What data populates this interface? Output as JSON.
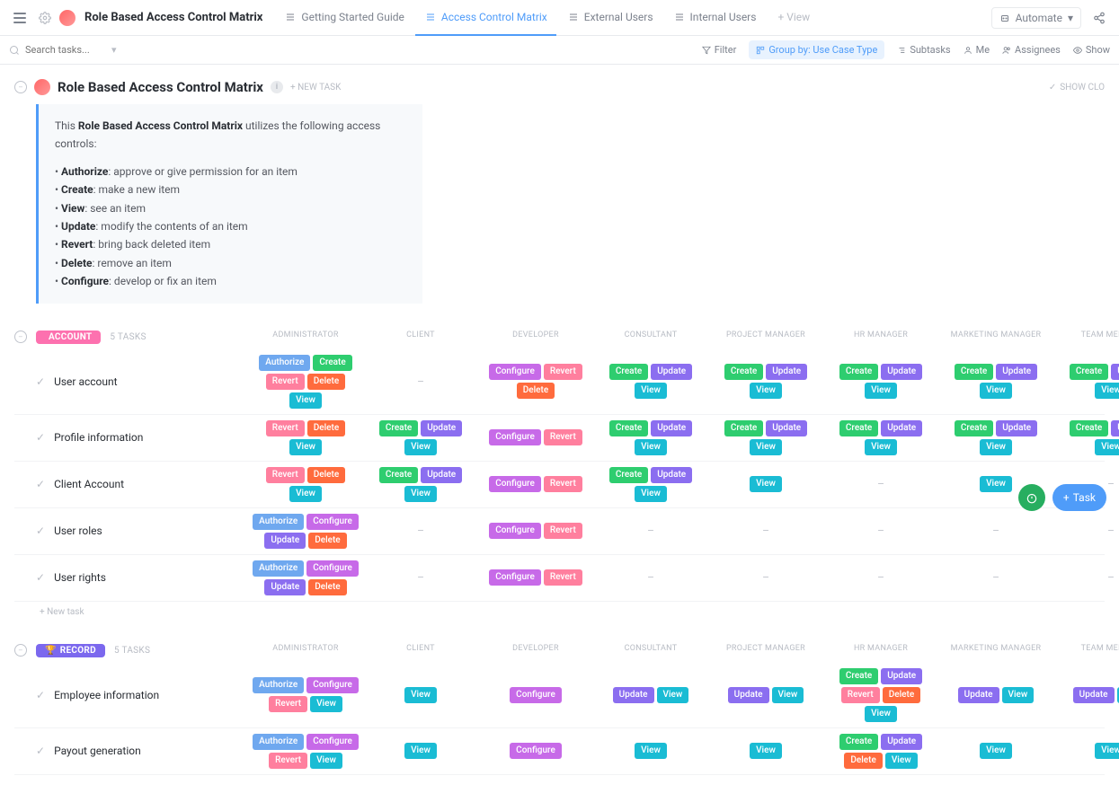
{
  "header": {
    "title": "Role Based Access Control Matrix",
    "automate": "Automate"
  },
  "tabs": [
    {
      "label": "Getting Started Guide",
      "active": false
    },
    {
      "label": "Access Control Matrix",
      "active": true
    },
    {
      "label": "External Users",
      "active": false
    },
    {
      "label": "Internal Users",
      "active": false
    }
  ],
  "add_view": "+ View",
  "search": {
    "placeholder": "Search tasks..."
  },
  "toolbar": {
    "filter": "Filter",
    "group_by": "Group by: Use Case Type",
    "subtasks": "Subtasks",
    "me": "Me",
    "assignees": "Assignees",
    "show": "Show"
  },
  "main": {
    "title": "Role Based Access Control Matrix",
    "new_task": "+ NEW TASK",
    "show_closed": "SHOW CLO"
  },
  "description": {
    "intro_pre": "This ",
    "intro_bold": "Role Based Access Control Matrix",
    "intro_post": " utilizes the following access controls:",
    "items": [
      {
        "term": "Authorize",
        "def": ": approve or give permission for an item"
      },
      {
        "term": "Create",
        "def": ": make a new item"
      },
      {
        "term": "View",
        "def": ": see an item"
      },
      {
        "term": "Update",
        "def": ": modify the contents of an item"
      },
      {
        "term": "Revert",
        "def": ": bring back deleted item"
      },
      {
        "term": "Delete",
        "def": ": remove an item"
      },
      {
        "term": "Configure",
        "def": ": develop or fix an item"
      }
    ]
  },
  "columns": [
    "ADMINISTRATOR",
    "CLIENT",
    "DEVELOPER",
    "CONSULTANT",
    "PROJECT MANAGER",
    "HR MANAGER",
    "MARKETING MANAGER",
    "TEAM MEMBER"
  ],
  "groups": [
    {
      "name": "ACCOUNT",
      "class": "account",
      "count": "5 TASKS",
      "tasks": [
        {
          "name": "User account",
          "cells": [
            [
              "Authorize",
              "Create",
              "Revert",
              "Delete",
              "View"
            ],
            [],
            [
              "Configure",
              "Revert",
              "Delete"
            ],
            [
              "Create",
              "Update",
              "View"
            ],
            [
              "Create",
              "Update",
              "View"
            ],
            [
              "Create",
              "Update",
              "View"
            ],
            [
              "Create",
              "Update",
              "View"
            ],
            [
              "Create",
              "Update",
              "View"
            ]
          ]
        },
        {
          "name": "Profile information",
          "cells": [
            [
              "Revert",
              "Delete",
              "View"
            ],
            [
              "Create",
              "Update",
              "View"
            ],
            [
              "Configure",
              "Revert"
            ],
            [
              "Create",
              "Update",
              "View"
            ],
            [
              "Create",
              "Update",
              "View"
            ],
            [
              "Create",
              "Update",
              "View"
            ],
            [
              "Create",
              "Update",
              "View"
            ],
            [
              "Create",
              "Update",
              "View"
            ]
          ]
        },
        {
          "name": "Client Account",
          "cells": [
            [
              "Revert",
              "Delete",
              "View"
            ],
            [
              "Create",
              "Update",
              "View"
            ],
            [
              "Configure",
              "Revert"
            ],
            [
              "Create",
              "Update",
              "View"
            ],
            [
              "View"
            ],
            [],
            [
              "View"
            ],
            []
          ]
        },
        {
          "name": "User roles",
          "cells": [
            [
              "Authorize",
              "Configure",
              "Update",
              "Delete"
            ],
            [],
            [
              "Configure",
              "Revert"
            ],
            [],
            [],
            [],
            [],
            []
          ]
        },
        {
          "name": "User rights",
          "cells": [
            [
              "Authorize",
              "Configure",
              "Update",
              "Delete"
            ],
            [],
            [
              "Configure",
              "Revert"
            ],
            [],
            [],
            [],
            [],
            []
          ]
        }
      ],
      "new_task": "+ New task"
    },
    {
      "name": "RECORD",
      "class": "record",
      "count": "5 TASKS",
      "tasks": [
        {
          "name": "Employee information",
          "cells": [
            [
              "Authorize",
              "Configure",
              "Revert",
              "View"
            ],
            [
              "View"
            ],
            [
              "Configure"
            ],
            [
              "Update",
              "View"
            ],
            [
              "Update",
              "View"
            ],
            [
              "Create",
              "Update",
              "Revert",
              "Delete",
              "View"
            ],
            [
              "Update",
              "View"
            ],
            [
              "Update",
              "View"
            ]
          ]
        },
        {
          "name": "Payout generation",
          "cells": [
            [
              "Authorize",
              "Configure",
              "Revert",
              "View"
            ],
            [
              "View"
            ],
            [
              "Configure"
            ],
            [
              "View"
            ],
            [
              "View"
            ],
            [
              "Create",
              "Update",
              "Delete",
              "View"
            ],
            [
              "View"
            ],
            [
              "View"
            ]
          ]
        }
      ]
    }
  ],
  "fab": {
    "task": "Task"
  }
}
